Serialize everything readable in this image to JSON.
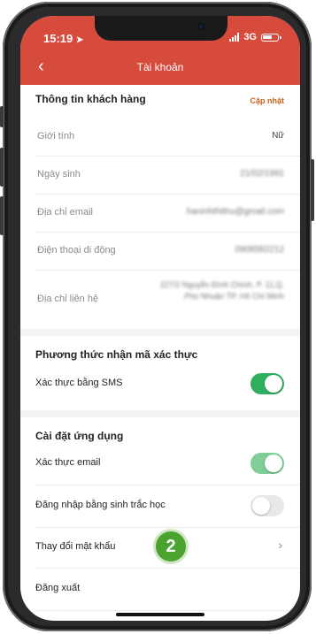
{
  "status": {
    "time": "15:19",
    "network": "3G"
  },
  "header": {
    "title": "Tài khoản"
  },
  "customer": {
    "heading": "Thông tin khách hàng",
    "update": "Cập nhật",
    "rows": [
      {
        "label": "Giới tính",
        "value": "Nữ"
      },
      {
        "label": "Ngày sinh",
        "value": "21/02/1991"
      },
      {
        "label": "Địa chỉ email",
        "value": "haninhthithu@gmail.com"
      },
      {
        "label": "Điện thoại di động",
        "value": "0908582212"
      },
      {
        "label": "Địa chỉ liên hệ",
        "value": "227/2 Nguyễn Đình Chính, P. 11,Q. Phú Nhuận TP. Hồ Chí Minh"
      }
    ]
  },
  "auth": {
    "heading": "Phương thức nhận mã xác thực",
    "sms_label": "Xác thực bằng SMS",
    "sms_on": true
  },
  "settings": {
    "heading": "Cài đặt ứng dụng",
    "email_label": "Xác thực email",
    "email_on": true,
    "biometric_label": "Đăng nhập bằng sinh trắc học",
    "biometric_on": false,
    "change_password": "Thay đổi mật khẩu",
    "logout": "Đăng xuất"
  },
  "step_badge": "2",
  "colors": {
    "header": "#d74b3d",
    "toggle_on": "#2fae5f",
    "update_link": "#c6621f",
    "badge": "#4aa22f"
  }
}
